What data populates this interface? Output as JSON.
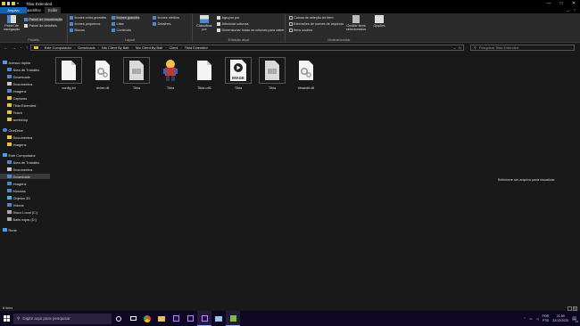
{
  "window": {
    "title": "Tibia Extended",
    "controls": [
      "—",
      "□",
      "✕"
    ]
  },
  "ribbon_tabs": {
    "file": "Arquivo",
    "home": "Início",
    "share": "Compartilhar",
    "view": "Exibir"
  },
  "ribbon": {
    "panes": {
      "label": "Painéis",
      "nav_pane": "Painel de navegação",
      "preview_pane": "Painel de visualização",
      "details_pane": "Painel de detalhes"
    },
    "layout": {
      "label": "Layout",
      "extra_large": "Ícones extra grandes",
      "large": "Ícones grandes",
      "medium": "Ícones médios",
      "small": "Ícones pequenos",
      "list": "Lista",
      "details": "Detalhes",
      "tiles": "Blocos",
      "content": "Conteúdo"
    },
    "current_view": {
      "label": "Exibição atual",
      "sort_by": "Classificar por",
      "group_by": "Agrupar por",
      "add_columns": "Adicionar colunas",
      "fit_columns": "Dimensionar todas as colunas para caber"
    },
    "show_hide": {
      "label": "Mostrar/ocultar",
      "item_checkboxes": "Caixas de seleção de item",
      "file_extensions": "Extensões de nomes de arquivos",
      "hidden_items": "Itens ocultos",
      "hide_selected": "Ocultar itens selecionados",
      "options": "Opções"
    }
  },
  "address": {
    "path": [
      "Este Computador",
      "Downloads",
      "Nto Client By Balt",
      "Nto Client By Balt",
      "Client",
      "Tibia Extended"
    ],
    "search_placeholder": "Pesquisar Tibia Extended"
  },
  "nav_pane": {
    "quick_access": "Acesso rápido",
    "quick_items": [
      "Área de Trabalho",
      "Downloads",
      "Documentos",
      "Imagens",
      "Capturas",
      "Tibia Extended",
      "Teach",
      "workshop"
    ],
    "onedrive": "OneDrive",
    "onedrive_items": [
      "Documentos",
      "Imagens"
    ],
    "this_pc": "Este Computador",
    "pc_items": [
      "Área de Trabalho",
      "Documentos",
      "Downloads",
      "Imagens",
      "Músicas",
      "Objetos 3D",
      "Vídeos",
      "Disco Local (C:)",
      "Balls nojas (D:)"
    ],
    "network": "Rede"
  },
  "files": [
    {
      "name": "config.ini",
      "type": "text"
    },
    {
      "name": "dxlrer.dll",
      "type": "dll"
    },
    {
      "name": "Tibia",
      "type": "blank"
    },
    {
      "name": "Tibia",
      "type": "character"
    },
    {
      "name": "Tibia.otf1",
      "type": "text"
    },
    {
      "name": "Tibia",
      "type": "image",
      "badge": "IMAGE"
    },
    {
      "name": "Tibia",
      "type": "blank"
    },
    {
      "name": "tibiaedit.dll",
      "type": "dll"
    }
  ],
  "preview_message": "Selecione um arquivo para visualizar.",
  "status": {
    "items": "8 itens"
  },
  "taskbar": {
    "search_placeholder": "Digite aqui para pesquisar",
    "language": "POR",
    "language_sub": "PTB",
    "time": "21:59",
    "date": "22/12/2020",
    "notifications": "13"
  }
}
